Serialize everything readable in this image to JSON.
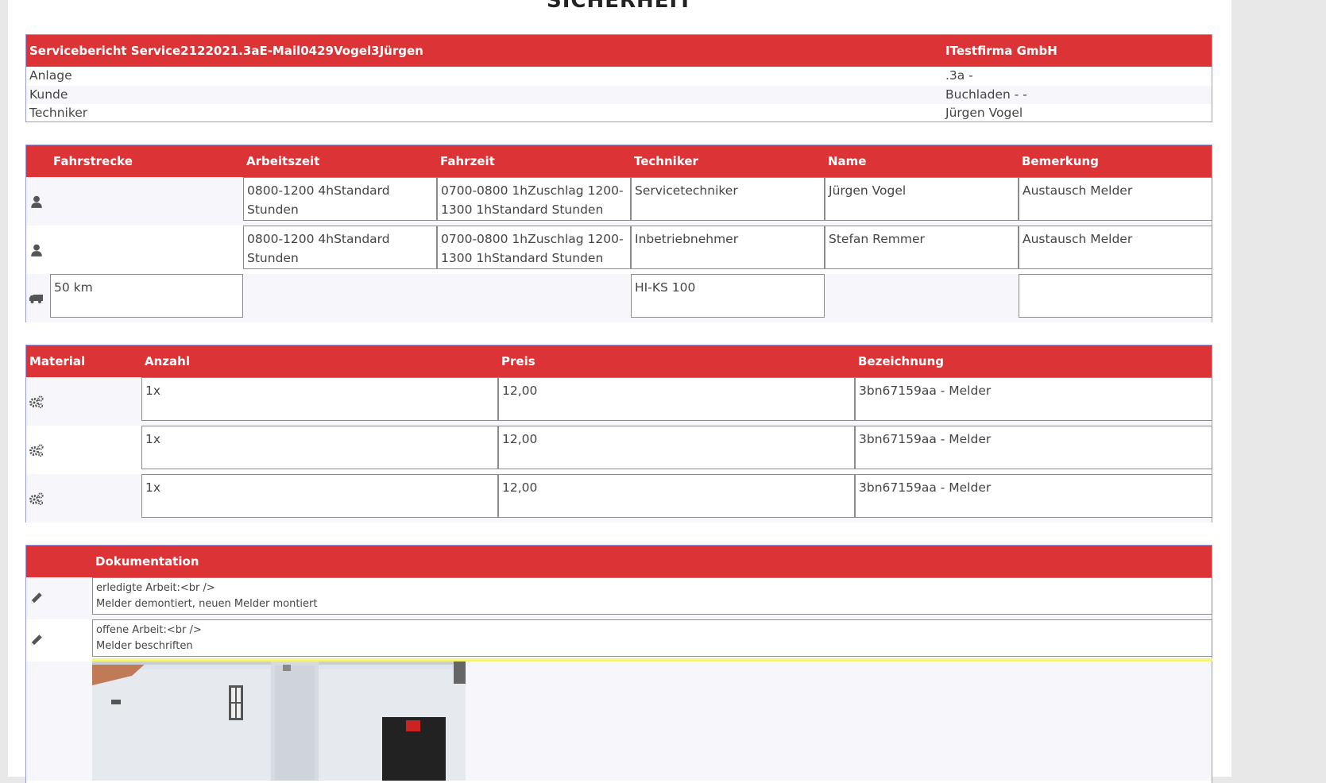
{
  "page_heading": "SICHERHEIT",
  "report": {
    "title": "Servicebericht Service2122021.3aE-Mail0429Vogel3Jürgen",
    "company": "ITestfirma GmbH",
    "rows": [
      {
        "label": "Anlage",
        "value": ".3a -"
      },
      {
        "label": "Kunde",
        "value": "Buchladen - -"
      },
      {
        "label": "Techniker",
        "value": "Jürgen Vogel"
      }
    ]
  },
  "work": {
    "headers": [
      "Fahrstrecke",
      "Arbeitszeit",
      "Fahrzeit",
      "Techniker",
      "Name",
      "Bemerkung"
    ],
    "rows": [
      {
        "icon": "user-icon",
        "arbeitszeit": "0800-1200 4hStandard Stunden",
        "fahrzeit": "0700-0800 1hZuschlag 1200-1300 1hStandard Stunden",
        "techniker": "Servicetechniker",
        "name": "Jürgen Vogel",
        "bemerkung": "Austausch Melder"
      },
      {
        "icon": "user-icon",
        "arbeitszeit": "0800-1200 4hStandard Stunden",
        "fahrzeit": "0700-0800 1hZuschlag 1200-1300 1hStandard Stunden",
        "techniker": "Inbetriebnehmer",
        "name": "Stefan Remmer",
        "bemerkung": "Austausch Melder"
      }
    ],
    "vehicle": {
      "icon": "truck-icon",
      "fahrstrecke": "50 km",
      "techniker": "HI-KS 100",
      "bemerkung": ""
    }
  },
  "material": {
    "headers": [
      "Material",
      "Anzahl",
      "Preis",
      "Bezeichnung"
    ],
    "rows": [
      {
        "icon": "gears-icon",
        "anzahl": "1x",
        "preis": "12,00",
        "bezeichnung": "3bn67159aa - Melder"
      },
      {
        "icon": "gears-icon",
        "anzahl": "1x",
        "preis": "12,00",
        "bezeichnung": "3bn67159aa - Melder"
      },
      {
        "icon": "gears-icon",
        "anzahl": "1x",
        "preis": "12,00",
        "bezeichnung": "3bn67159aa - Melder"
      }
    ]
  },
  "documentation": {
    "header": "Dokumentation",
    "entries": [
      {
        "icon": "pencil-icon",
        "line1": "erledigte Arbeit:<br />",
        "line2": "Melder demontiert, neuen Melder montiert"
      },
      {
        "icon": "pencil-icon",
        "line1": "offene Arbeit:<br />",
        "line2": "Melder beschriften"
      }
    ]
  },
  "colors": {
    "accent": "#dc3436",
    "border": "#9a9ad8",
    "highlight": "#f5f57a"
  }
}
